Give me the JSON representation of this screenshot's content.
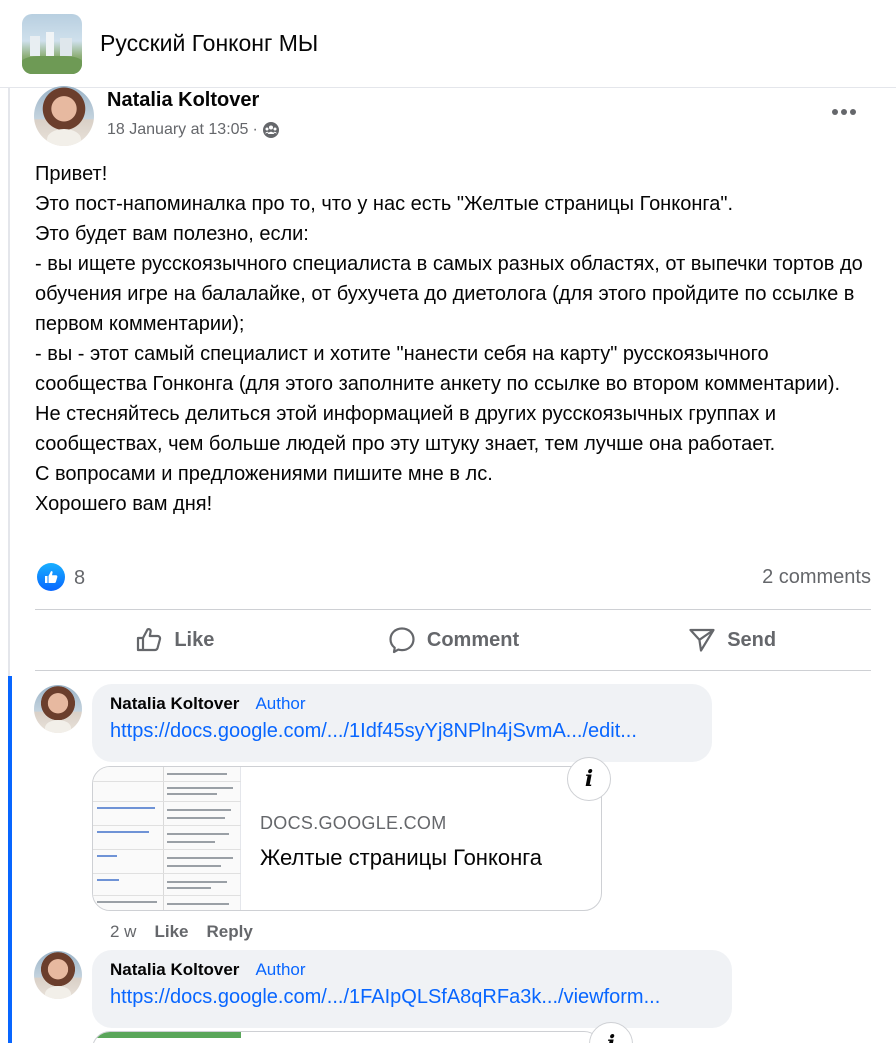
{
  "group": {
    "title": "Русский Гонконг МЫ"
  },
  "post": {
    "author": "Natalia Koltover",
    "timestamp": "18 January at 13:05",
    "separator": "·",
    "body": "Привет!\nЭто пост-напоминалка про то, что у нас есть \"Желтые страницы Гонконга\".\nЭто будет вам полезно, если:\n- вы ищете русскоязычного специалиста в самых разных областях, от выпечки тортов до обучения игре на балалайке, от бухучета до диетолога (для этого пройдите по ссылке в первом комментарии);\n- вы - этот самый специалист и хотите \"нанести себя на карту\" русскоязычного сообщества Гонконга (для этого заполните анкету по ссылке во втором комментарии).\nНе стесняйтесь делиться этой информацией в других русскоязычных группах и сообществах, чем больше людей про эту штуку знает, тем лучше она работает.\nС вопросами и предложениями пишите мне в лс.\nХорошего вам дня!",
    "reaction_count": "8",
    "comments_count": "2 comments",
    "actions": {
      "like": "Like",
      "comment": "Comment",
      "send": "Send"
    }
  },
  "comments": [
    {
      "author": "Natalia Koltover",
      "badge": "Author",
      "link": "https://docs.google.com/.../1Idf45syYj8NPln4jSvmA.../edit...",
      "card": {
        "domain": "DOCS.GOOGLE.COM",
        "title": "Желтые страницы Гонконга"
      },
      "age": "2 w",
      "like": "Like",
      "reply": "Reply"
    },
    {
      "author": "Natalia Koltover",
      "badge": "Author",
      "link": "https://docs.google.com/.../1FAIpQLSfA8qRFa3k.../viewform..."
    }
  ],
  "icons": {
    "info": "i"
  },
  "colors": {
    "accent": "#0866ff",
    "secondary_text": "#65676b",
    "bubble": "#f0f2f5"
  }
}
